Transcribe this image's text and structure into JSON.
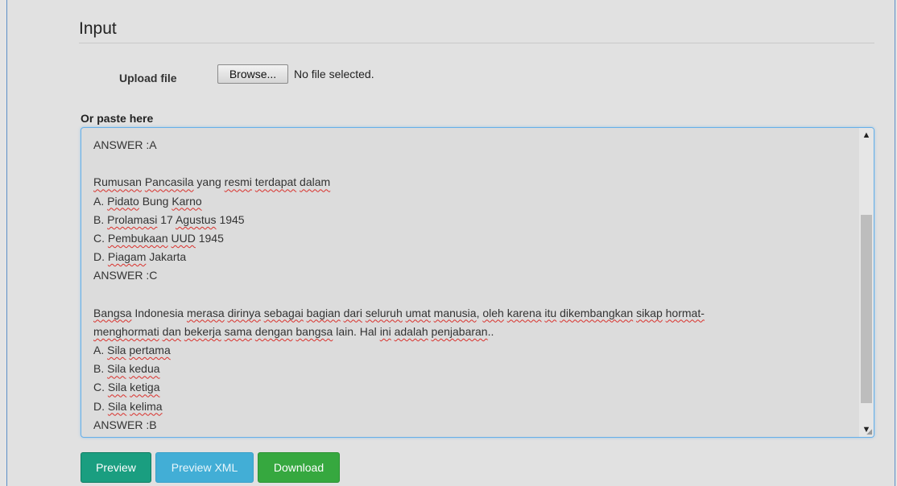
{
  "panel": {
    "title": "Input"
  },
  "upload": {
    "label": "Upload file",
    "browse_label": "Browse...",
    "status": "No file selected."
  },
  "paste": {
    "label": "Or paste here",
    "lines": [
      "ANSWER :A",
      "",
      "Rumusan Pancasila yang resmi terdapat dalam",
      "A. Pidato Bung Karno",
      "B. Prolamasi 17 Agustus 1945",
      "C. Pembukaan UUD 1945",
      "D. Piagam Jakarta",
      "ANSWER :C",
      "",
      "Bangsa Indonesia merasa dirinya sebagai bagian dari seluruh umat manusia, oleh karena itu dikembangkan sikap hormat-",
      "menghormati dan bekerja sama dengan bangsa lain. Hal ini adalah penjabaran..",
      "A. Sila pertama",
      "B. Sila kedua",
      "C. Sila ketiga",
      "D. Sila kelima",
      "ANSWER :B"
    ]
  },
  "actions": {
    "preview_label": "Preview",
    "preview_xml_label": "Preview XML",
    "download_label": "Download"
  },
  "colors": {
    "preview": "#1a9e80",
    "preview_xml": "#42aed6",
    "download": "#36a83f",
    "focus_border": "#66afe9",
    "spell_underline": "#d9302b"
  },
  "icons": {
    "scroll_up": "▲",
    "scroll_down": "▼"
  }
}
